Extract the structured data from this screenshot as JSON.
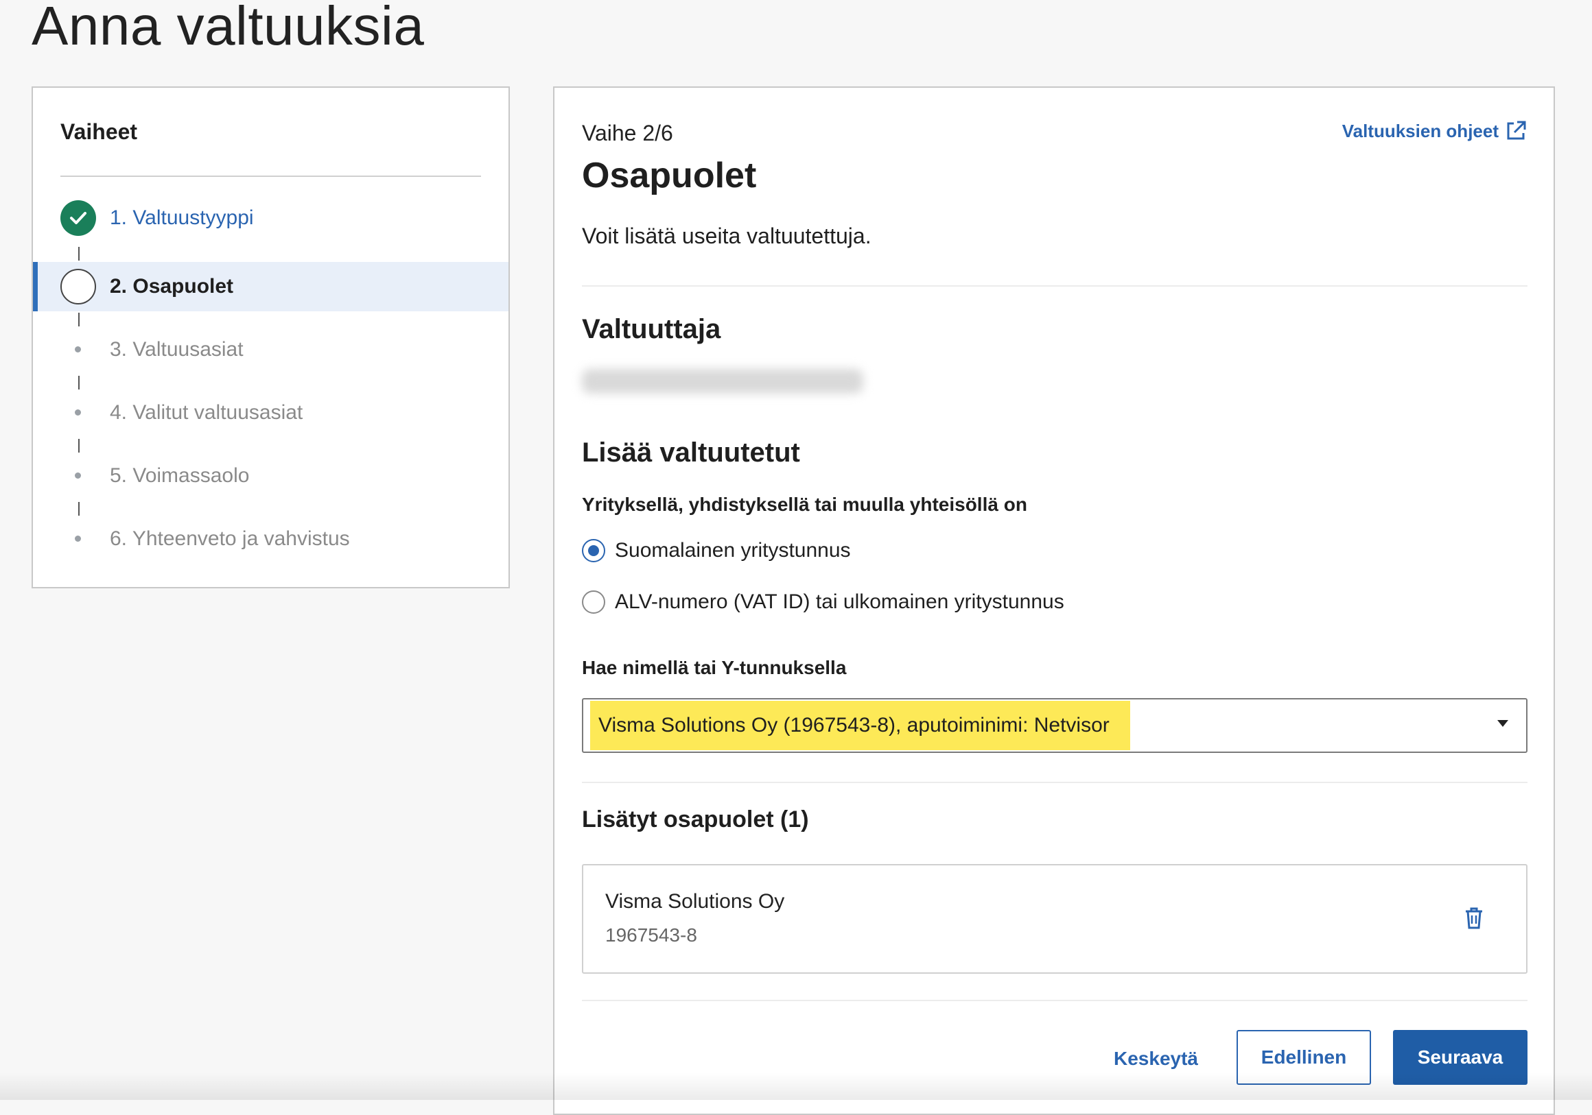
{
  "page": {
    "title": "Anna valtuuksia"
  },
  "steps": {
    "title": "Vaiheet",
    "items": [
      {
        "label": "1. Valtuustyyppi",
        "state": "done"
      },
      {
        "label": "2. Osapuolet",
        "state": "current"
      },
      {
        "label": "3. Valtuusasiat",
        "state": "todo"
      },
      {
        "label": "4. Valitut valtuusasiat",
        "state": "todo"
      },
      {
        "label": "5. Voimassaolo",
        "state": "todo"
      },
      {
        "label": "6. Yhteenveto ja vahvistus",
        "state": "todo"
      }
    ]
  },
  "main": {
    "step_counter": "Vaihe 2/6",
    "help_link": "Valtuuksien ohjeet",
    "title": "Osapuolet",
    "intro": "Voit lisätä useita valtuutettuja.",
    "grantor_heading": "Valtuuttaja",
    "add_heading": "Lisää valtuutetut",
    "entity_question": "Yrityksellä, yhdistyksellä tai muulla yhteisöllä on",
    "radio_options": [
      {
        "label": "Suomalainen yritystunnus",
        "checked": true
      },
      {
        "label": "ALV-numero (VAT ID) tai ulkomainen yritystunnus",
        "checked": false
      }
    ],
    "search_label": "Hae nimellä tai Y-tunnuksella",
    "search_value": "Visma Solutions Oy (1967543-8), aputoiminimi: Netvisor",
    "added_heading": "Lisätyt osapuolet (1)",
    "added_parties": [
      {
        "name": "Visma Solutions Oy",
        "id": "1967543-8"
      }
    ],
    "buttons": {
      "cancel": "Keskeytä",
      "previous": "Edellinen",
      "next": "Seuraava"
    }
  },
  "colors": {
    "accent": "#2a64b0",
    "done": "#1a7f5a",
    "highlight": "#fde957",
    "primary_button": "#1f5da6"
  }
}
